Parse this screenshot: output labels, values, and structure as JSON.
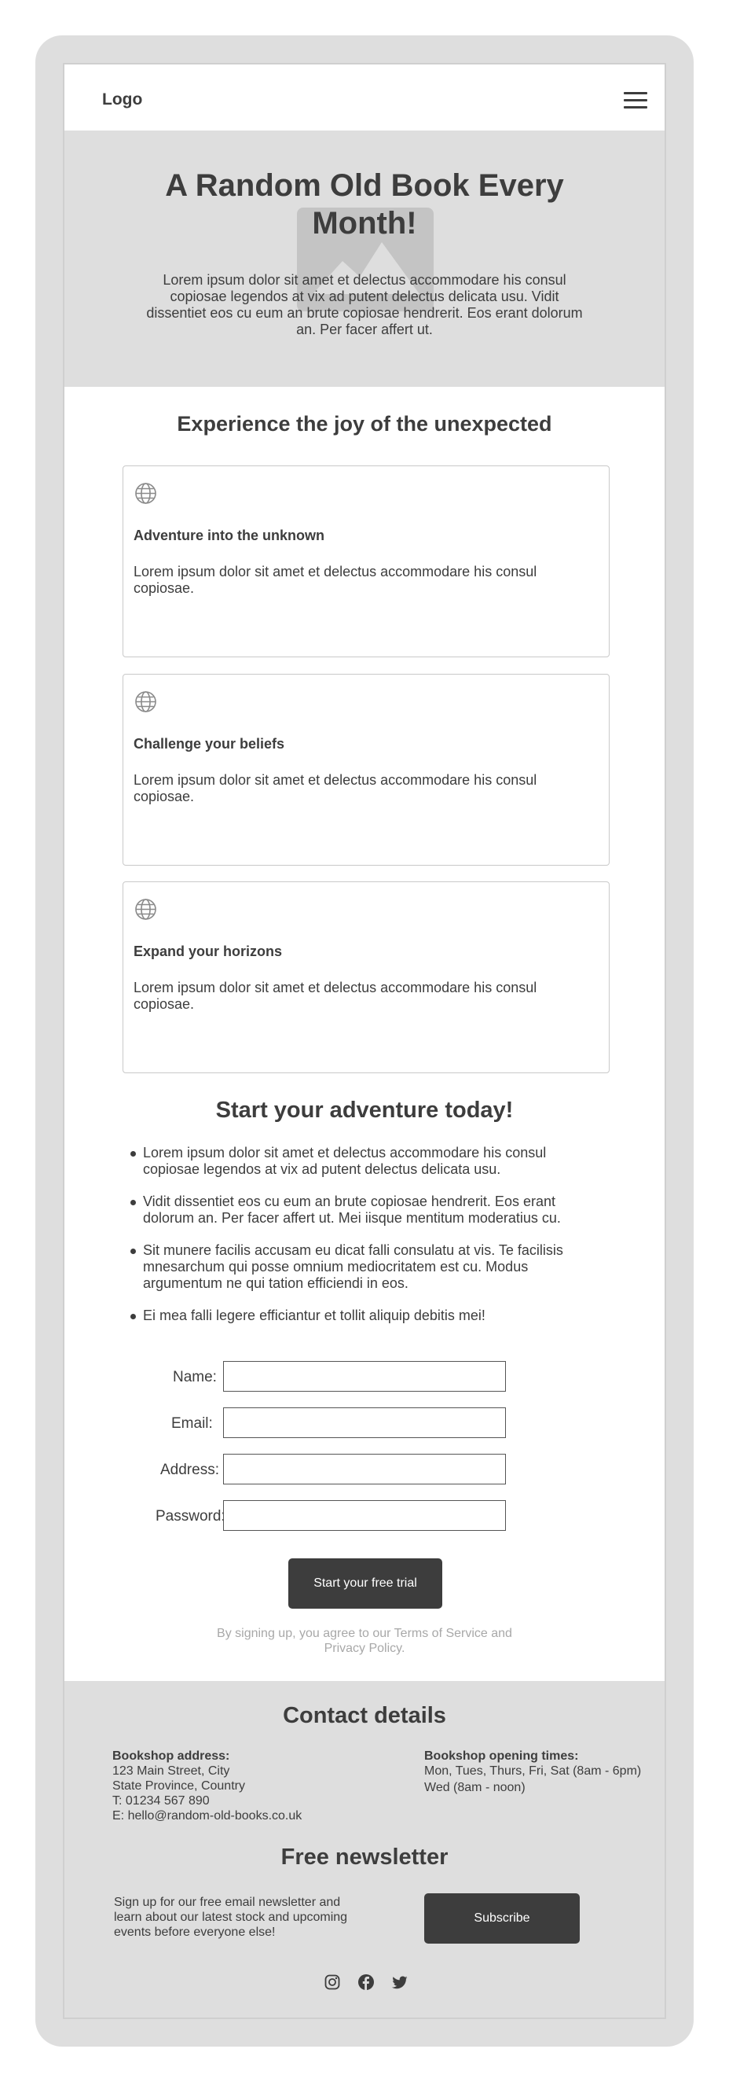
{
  "header": {
    "logo": "Logo",
    "menu_icon": "hamburger-menu-icon"
  },
  "hero": {
    "title": "A Random Old Book Every Month!",
    "image_icon": "image-placeholder-icon",
    "text": "Lorem ipsum dolor sit amet et delectus accommodare his consul copiosae legendos at vix ad putent delectus delicata usu. Vidit dissentiet eos cu eum an brute copiosae hendrerit. Eos erant dolorum an. Per facer affert ut."
  },
  "features": {
    "title": "Experience the joy of the unexpected",
    "cards": [
      {
        "icon": "globe-icon",
        "title": "Adventure into the unknown",
        "text": "Lorem ipsum dolor sit amet et delectus accommodare his consul copiosae."
      },
      {
        "icon": "globe-icon",
        "title": "Challenge your beliefs",
        "text": "Lorem ipsum dolor sit amet et delectus accommodare his consul copiosae."
      },
      {
        "icon": "globe-icon",
        "title": "Expand your horizons",
        "text": "Lorem ipsum dolor sit amet et delectus accommodare his consul copiosae."
      }
    ]
  },
  "adventure": {
    "title": "Start your adventure today!",
    "items": [
      "Lorem ipsum dolor sit amet et delectus accommodare his consul copiosae legendos at vix ad putent delectus delicata usu.",
      "Vidit dissentiet eos cu eum an brute copiosae hendrerit. Eos erant dolorum an. Per facer affert ut. Mei iisque mentitum moderatius cu.",
      "Sit munere facilis accusam eu dicat falli consulatu at vis. Te facilisis mnesarchum qui posse omnium mediocritatem est cu. Modus argumentum ne qui tation efficiendi in eos.",
      "Ei mea falli legere efficiantur et tollit aliquip debitis mei!"
    ]
  },
  "form": {
    "name_label": "Name:",
    "name_value": "",
    "email_label": "Email:",
    "email_value": "",
    "address_label": "Address:",
    "address_value": "",
    "password_label": "Password:",
    "password_value": "",
    "submit_label": "Start your free trial",
    "terms": "By signing up, you agree to our Terms of Service and Privacy Policy."
  },
  "footer": {
    "contact_title": "Contact details",
    "address_heading": "Bookshop address:",
    "address_line1": "123 Main Street, City",
    "address_line2": "State Province, Country",
    "phone": "T: 01234 567 890",
    "email": "E: hello@random-old-books.co.uk",
    "hours_heading": "Bookshop opening times:",
    "hours_line1": "Mon, Tues, Thurs, Fri, Sat (8am - 6pm)",
    "hours_line2": "Wed (8am - noon)",
    "newsletter_title": "Free newsletter",
    "newsletter_text": "Sign up for our free email newsletter and learn about our latest stock and upcoming events before everyone else!",
    "subscribe_label": "Subscribe",
    "social_icons": [
      "instagram-icon",
      "facebook-icon",
      "twitter-icon"
    ]
  },
  "colors": {
    "device_frame": "#dedede",
    "text": "#3d3d3d",
    "button": "#3d3d3d",
    "muted_text": "#a8a8a8"
  }
}
